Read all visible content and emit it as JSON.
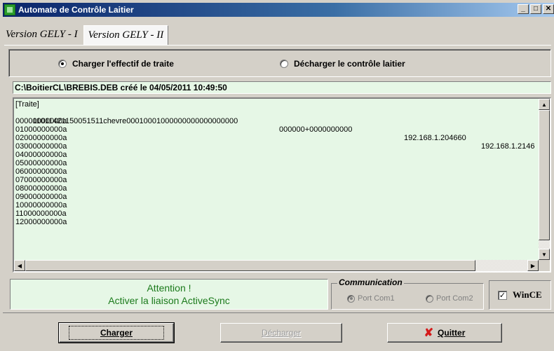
{
  "window": {
    "title": "Automate de Contrôle Laitier",
    "controls": [
      "_",
      "□",
      "✕"
    ]
  },
  "tabs": [
    {
      "label": "Version GELY - I"
    },
    {
      "label": "Version GELY - II"
    }
  ],
  "mode": {
    "option1": "Charger l'effectif de traite",
    "option2": "Décharger le contrôle laitier",
    "selected": "option1"
  },
  "path": "C:\\BoitierCL\\BREBIS.DEB créé le 04/05/2011 10:49:50",
  "content": {
    "header": "[Traite]",
    "row1": {
      "c1": "11011421150051511chevre00010001000000000000000000",
      "c2": "000000+0000000000",
      "c3": "192.168.1.204660",
      "c4": "192.168.1.2146"
    },
    "lines": [
      "00000000000a",
      "01000000000a",
      "02000000000a",
      "03000000000a",
      "04000000000a",
      "05000000000a",
      "06000000000a",
      "07000000000a",
      "08000000000a",
      "09000000000a",
      "10000000000a",
      "11000000000a",
      "12000000000a"
    ]
  },
  "message": {
    "line1": "Attention !",
    "line2": "Activer la liaison ActiveSync",
    "color": "#1b7a1b"
  },
  "communication": {
    "legend": "Communication",
    "port1": "Port Com1",
    "port2": "Port Com2",
    "wince_label": "WinCE",
    "wince_checked": true
  },
  "buttons": {
    "charger": "Charger",
    "decharger": "Décharger",
    "quitter": "Quitter"
  }
}
